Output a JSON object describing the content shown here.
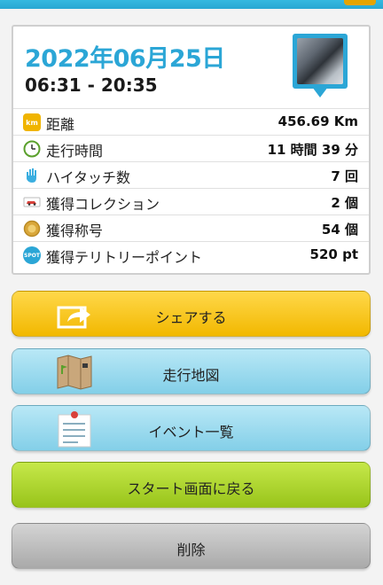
{
  "header": {
    "date": "2022年06月25日",
    "time_range": "06:31 - 20:35"
  },
  "stats": [
    {
      "icon": "km-icon",
      "icon_text": "km",
      "label": "距離",
      "value": "456.69 Km"
    },
    {
      "icon": "clock-icon",
      "icon_text": "",
      "label": "走行時間",
      "value": "11 時間 39 分"
    },
    {
      "icon": "hand-icon",
      "icon_text": "",
      "label": "ハイタッチ数",
      "value": "7 回"
    },
    {
      "icon": "car-icon",
      "icon_text": "",
      "label": "獲得コレクション",
      "value": "2 個"
    },
    {
      "icon": "medal-icon",
      "icon_text": "",
      "label": "獲得称号",
      "value": "54 個"
    },
    {
      "icon": "spot-icon",
      "icon_text": "SPOT",
      "label": "獲得テリトリーポイント",
      "value": "520 pt"
    }
  ],
  "buttons": {
    "share": "シェアする",
    "map": "走行地図",
    "events": "イベント一覧",
    "start": "スタート画面に戻る",
    "delete": "削除"
  },
  "colors": {
    "accent": "#2ba6d6",
    "share": "#f2b800",
    "start": "#98c41a",
    "delete": "#a9a9a9"
  }
}
